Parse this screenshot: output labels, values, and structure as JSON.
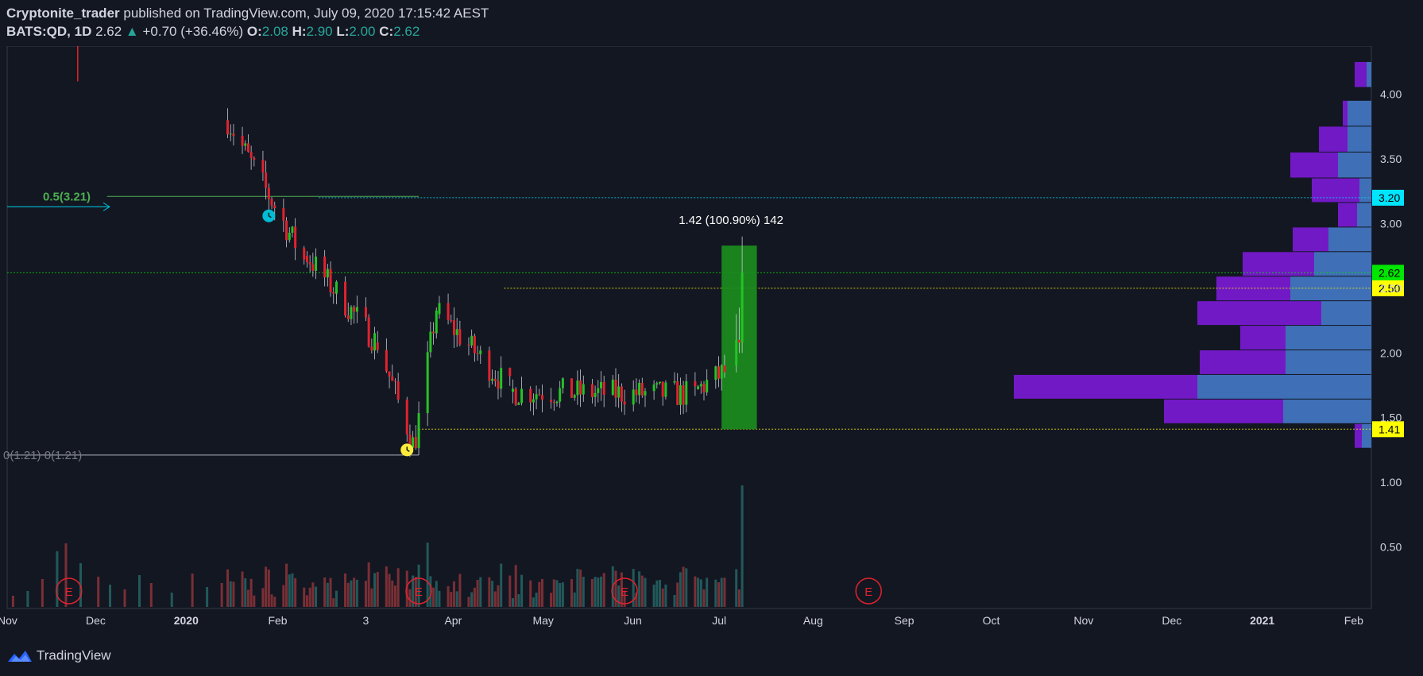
{
  "header": {
    "author": "Cryptonite_trader",
    "published": "published on TradingView.com, July 09, 2020 17:15:42 AEST",
    "symbol": "BATS:QD, 1D",
    "last": "2.62",
    "change": "+0.70 (+36.46%)",
    "o_label": "O:",
    "o": "2.08",
    "h_label": "H:",
    "h": "2.90",
    "l_label": "L:",
    "l": "2.00",
    "c_label": "C:",
    "c": "2.62"
  },
  "footer": {
    "brand": "TradingView"
  },
  "chart_data": {
    "type": "candlestick",
    "ylim": [
      0.3,
      4.25
    ],
    "y_ticks": [
      0.5,
      1.0,
      1.5,
      2.0,
      2.5,
      3.0,
      3.5,
      4.0
    ],
    "x_ticks": [
      {
        "label": "Nov",
        "x": "2019-11-01"
      },
      {
        "label": "Dec",
        "x": "2019-12-01"
      },
      {
        "label": "2020",
        "x": "2020-01-01"
      },
      {
        "label": "Feb",
        "x": "2020-02-01"
      },
      {
        "label": "3",
        "x": "2020-03-02"
      },
      {
        "label": "Apr",
        "x": "2020-04-01"
      },
      {
        "label": "May",
        "x": "2020-05-01"
      },
      {
        "label": "Jun",
        "x": "2020-06-01"
      },
      {
        "label": "Jul",
        "x": "2020-07-01"
      },
      {
        "label": "Aug",
        "x": "2020-08-01"
      },
      {
        "label": "Sep",
        "x": "2020-09-01"
      },
      {
        "label": "Oct",
        "x": "2020-10-01"
      },
      {
        "label": "Nov",
        "x": "2020-11-01"
      },
      {
        "label": "Dec",
        "x": "2020-12-01"
      },
      {
        "label": "2021",
        "x": "2021-01-01"
      },
      {
        "label": "Feb",
        "x": "2021-02-01"
      }
    ],
    "x_range": [
      "2019-11-01",
      "2021-02-07"
    ],
    "up_color": "#26c226",
    "down_color": "#e0232e",
    "segments": [
      {
        "start": "2020-01-15",
        "end": "2020-02-10",
        "from": 3.8,
        "to": 2.72
      },
      {
        "start": "2020-02-11",
        "end": "2020-03-05",
        "from": 2.75,
        "to": 2.1
      },
      {
        "start": "2020-03-06",
        "end": "2020-03-18",
        "from": 2.08,
        "to": 1.3
      },
      {
        "start": "2020-03-19",
        "end": "2020-03-26",
        "from": 1.35,
        "to": 2.35
      },
      {
        "start": "2020-03-27",
        "end": "2020-04-20",
        "from": 2.3,
        "to": 1.72
      },
      {
        "start": "2020-04-21",
        "end": "2020-06-22",
        "from": 1.7,
        "to": 1.68
      },
      {
        "start": "2020-06-23",
        "end": "2020-07-02",
        "from": 1.72,
        "to": 1.85
      }
    ],
    "last_candles": [
      {
        "x": "2020-07-06",
        "o": 1.9,
        "h": 2.3,
        "l": 1.85,
        "c": 2.1
      },
      {
        "x": "2020-07-07",
        "o": 2.1,
        "h": 2.35,
        "l": 2.0,
        "c": 2.08
      },
      {
        "x": "2020-07-08",
        "o": 2.08,
        "h": 2.9,
        "l": 2.0,
        "c": 2.62
      }
    ],
    "volume_peak_x": "2020-07-08",
    "earnings_markers": [
      "2019-11-22",
      "2020-03-20",
      "2020-05-29",
      "2020-08-20"
    ],
    "earnings_label": "E",
    "horizontal_lines": [
      {
        "value": 3.2,
        "label": "3.20",
        "color": "#00e5ff"
      },
      {
        "value": 2.62,
        "label": "2.62",
        "color": "#00e600"
      },
      {
        "value": 2.5,
        "label": "2.50",
        "color": "#ffff00"
      },
      {
        "value": 1.41,
        "label": "1.41",
        "color": "#ffff00"
      }
    ],
    "fib_top_label": "0.5(3.21)",
    "fib_bottom_labels": "0(1.21)  0(1.21)",
    "fib_top_value": 3.21,
    "fib_bottom_value": 1.21,
    "measure": {
      "label": "1.42 (100.90%) 142",
      "from": 1.41,
      "to": 2.83,
      "start": "2020-07-01",
      "end": "2020-07-13"
    },
    "volume_profile": [
      {
        "low": 4.05,
        "high": 4.25,
        "up": 0.02,
        "down": 0.05
      },
      {
        "low": 3.75,
        "high": 3.95,
        "up": 0.1,
        "down": 0.02
      },
      {
        "low": 3.55,
        "high": 3.75,
        "up": 0.1,
        "down": 0.12
      },
      {
        "low": 3.35,
        "high": 3.55,
        "up": 0.14,
        "down": 0.2
      },
      {
        "low": 3.16,
        "high": 3.35,
        "up": 0.05,
        "down": 0.2
      },
      {
        "low": 2.97,
        "high": 3.16,
        "up": 0.06,
        "down": 0.08
      },
      {
        "low": 2.78,
        "high": 2.97,
        "up": 0.18,
        "down": 0.15
      },
      {
        "low": 2.59,
        "high": 2.78,
        "up": 0.24,
        "down": 0.3
      },
      {
        "low": 2.4,
        "high": 2.59,
        "up": 0.34,
        "down": 0.31
      },
      {
        "low": 2.21,
        "high": 2.4,
        "up": 0.21,
        "down": 0.52
      },
      {
        "low": 2.02,
        "high": 2.21,
        "up": 0.36,
        "down": 0.19
      },
      {
        "low": 1.83,
        "high": 2.02,
        "up": 0.36,
        "down": 0.36
      },
      {
        "low": 1.64,
        "high": 1.83,
        "up": 0.73,
        "down": 0.77
      },
      {
        "low": 1.45,
        "high": 1.64,
        "up": 0.37,
        "down": 0.5
      },
      {
        "low": 1.26,
        "high": 1.45,
        "up": 0.04,
        "down": 0.03
      }
    ]
  }
}
